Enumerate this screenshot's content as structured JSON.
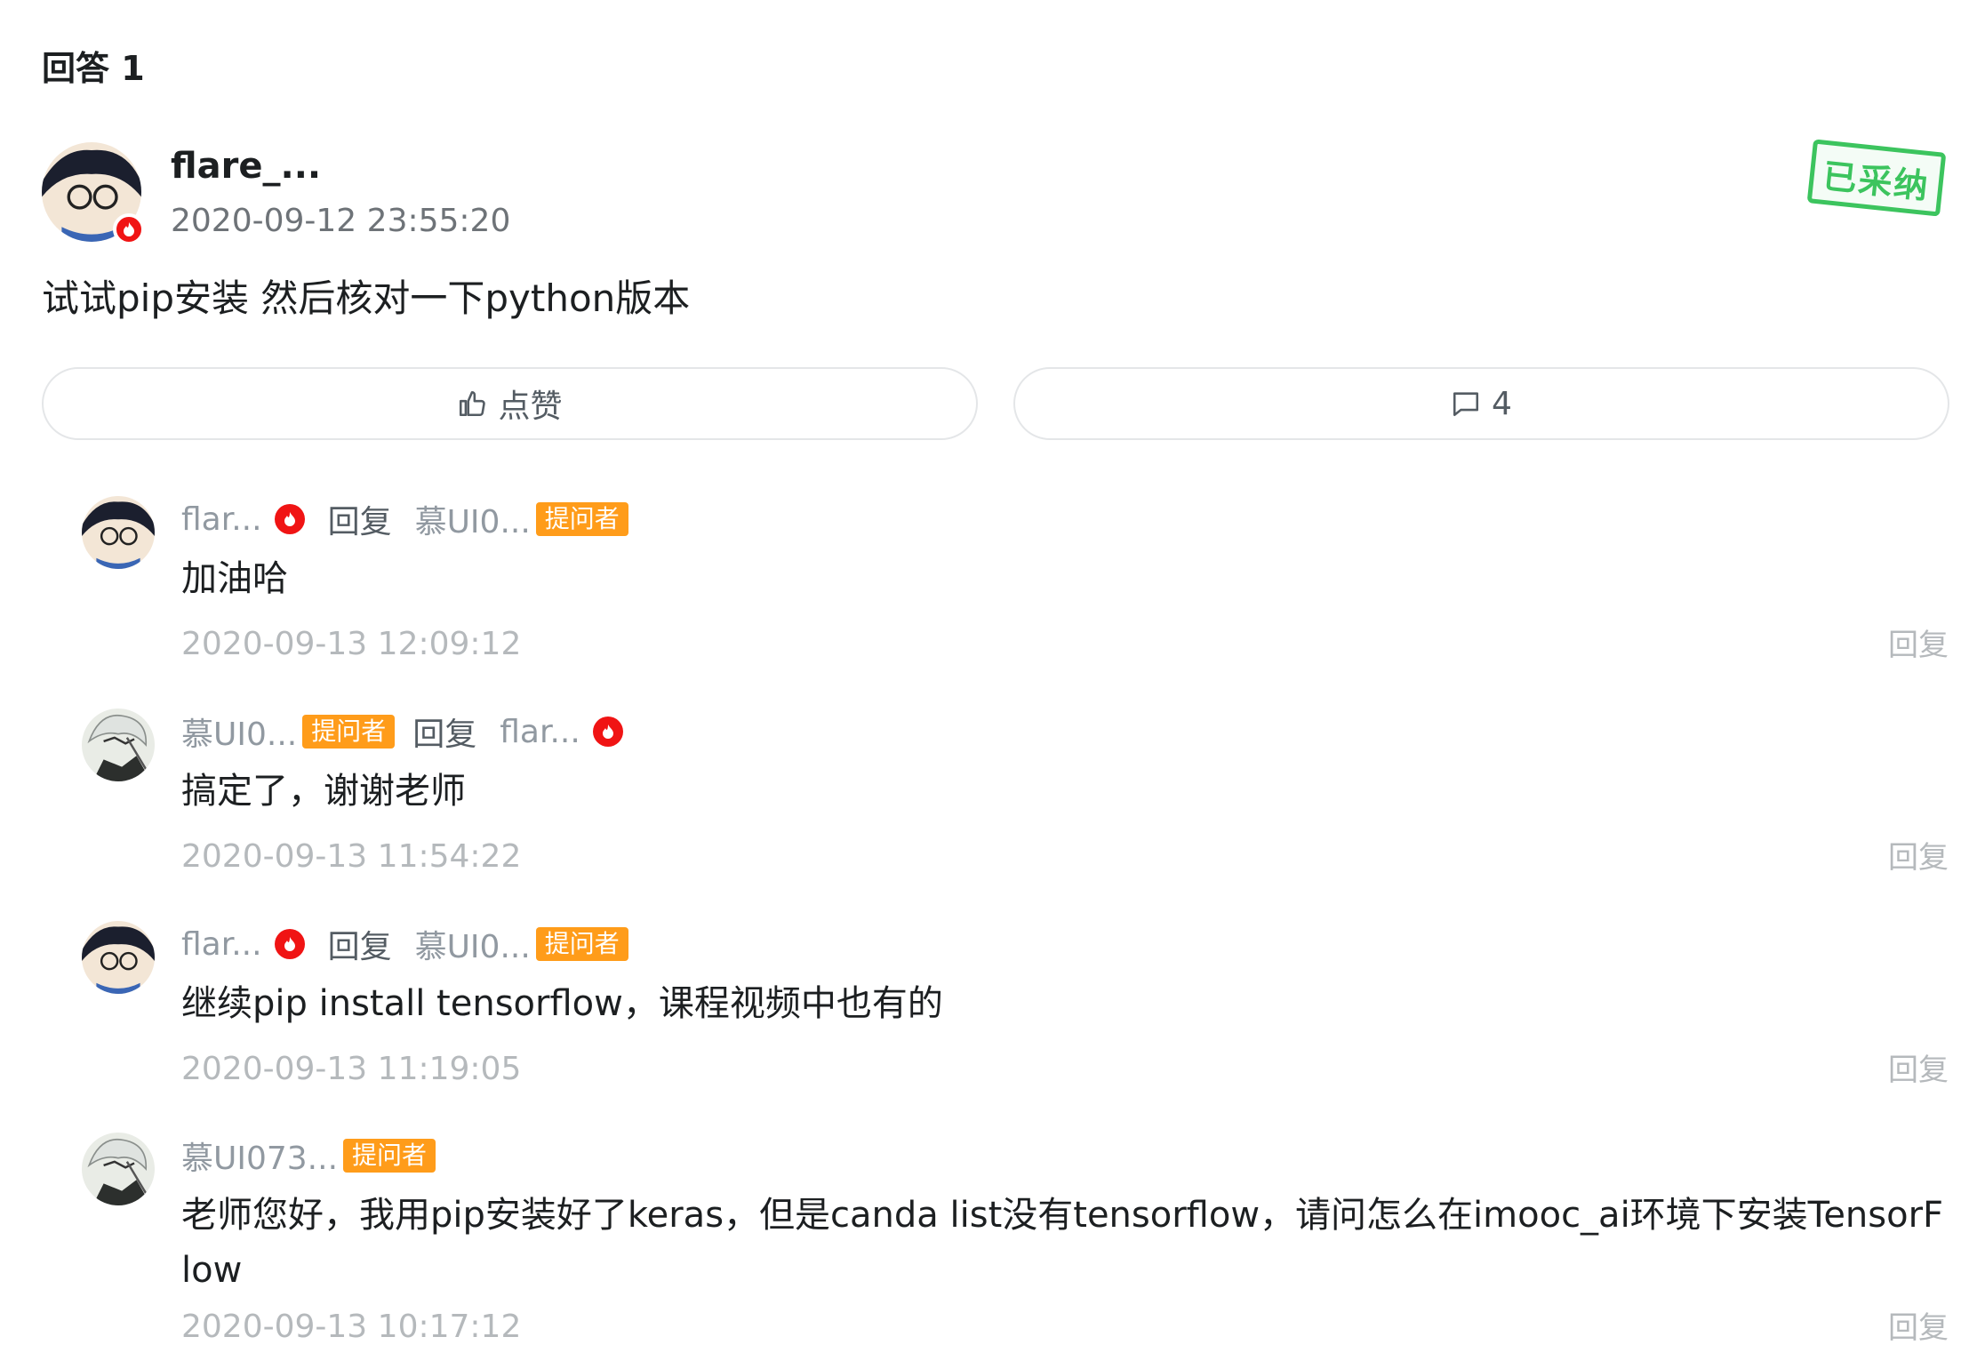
{
  "section_title": "回答 1",
  "answer": {
    "author": "flare_...",
    "time": "2020-09-12 23:55:20",
    "adopted_label": "已采纳",
    "content": "试试pip安装 然后核对一下python版本",
    "like_label": "点赞",
    "comment_count": "4"
  },
  "replies": [
    {
      "from": "flar...",
      "verb": "回复",
      "to": "慕UI0...",
      "to_badge": "提问者",
      "text": "加油哈",
      "time": "2020-09-13 12:09:12",
      "reply_link": "回复"
    },
    {
      "from": "慕UI0...",
      "from_badge": "提问者",
      "verb": "回复",
      "to": "flar...",
      "text": "搞定了，谢谢老师",
      "time": "2020-09-13 11:54:22",
      "reply_link": "回复"
    },
    {
      "from": "flar...",
      "verb": "回复",
      "to": "慕UI0...",
      "to_badge": "提问者",
      "text": "继续pip install tensorflow，课程视频中也有的",
      "time": "2020-09-13 11:19:05",
      "reply_link": "回复"
    },
    {
      "from": "慕UI073...",
      "from_badge": "提问者",
      "text": "老师您好，我用pip安装好了keras，但是canda list没有tensorflow，请问怎么在imooc_ai环境下安装TensorFlow",
      "time": "2020-09-13 10:17:12",
      "reply_link": "回复"
    }
  ],
  "colors": {
    "accent_red": "#f01414",
    "asker_orange": "#ff9c1a",
    "adopted_green": "#3cc45e",
    "muted_text": "#9199a1"
  }
}
